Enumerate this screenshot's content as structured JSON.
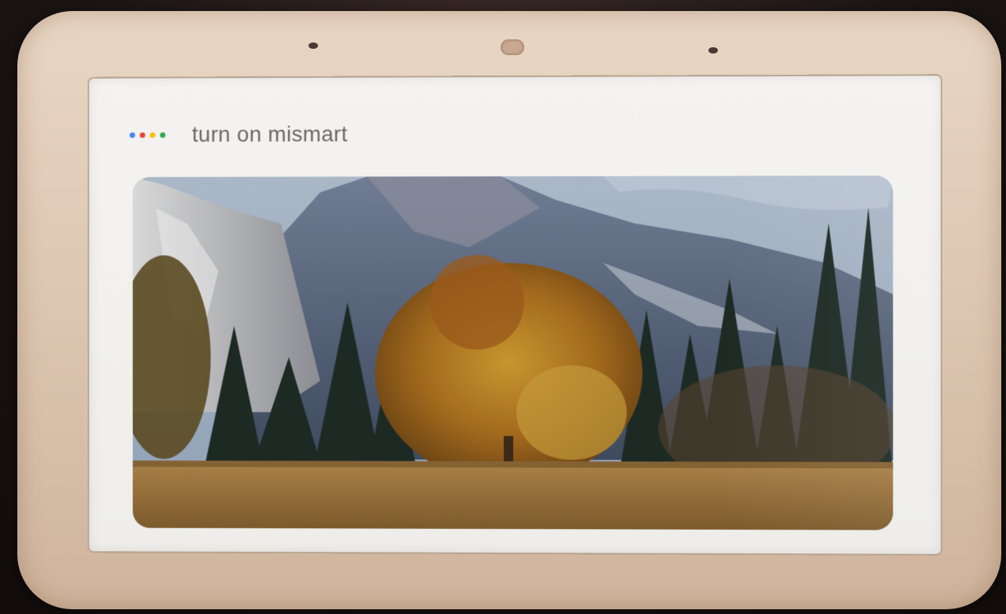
{
  "assistant": {
    "query": "turn on mismart",
    "dot_colors": [
      "#4285F4",
      "#EA4335",
      "#FBBC05",
      "#34A853"
    ]
  },
  "photo": {
    "subject": "mountain-valley-autumn-tree"
  }
}
